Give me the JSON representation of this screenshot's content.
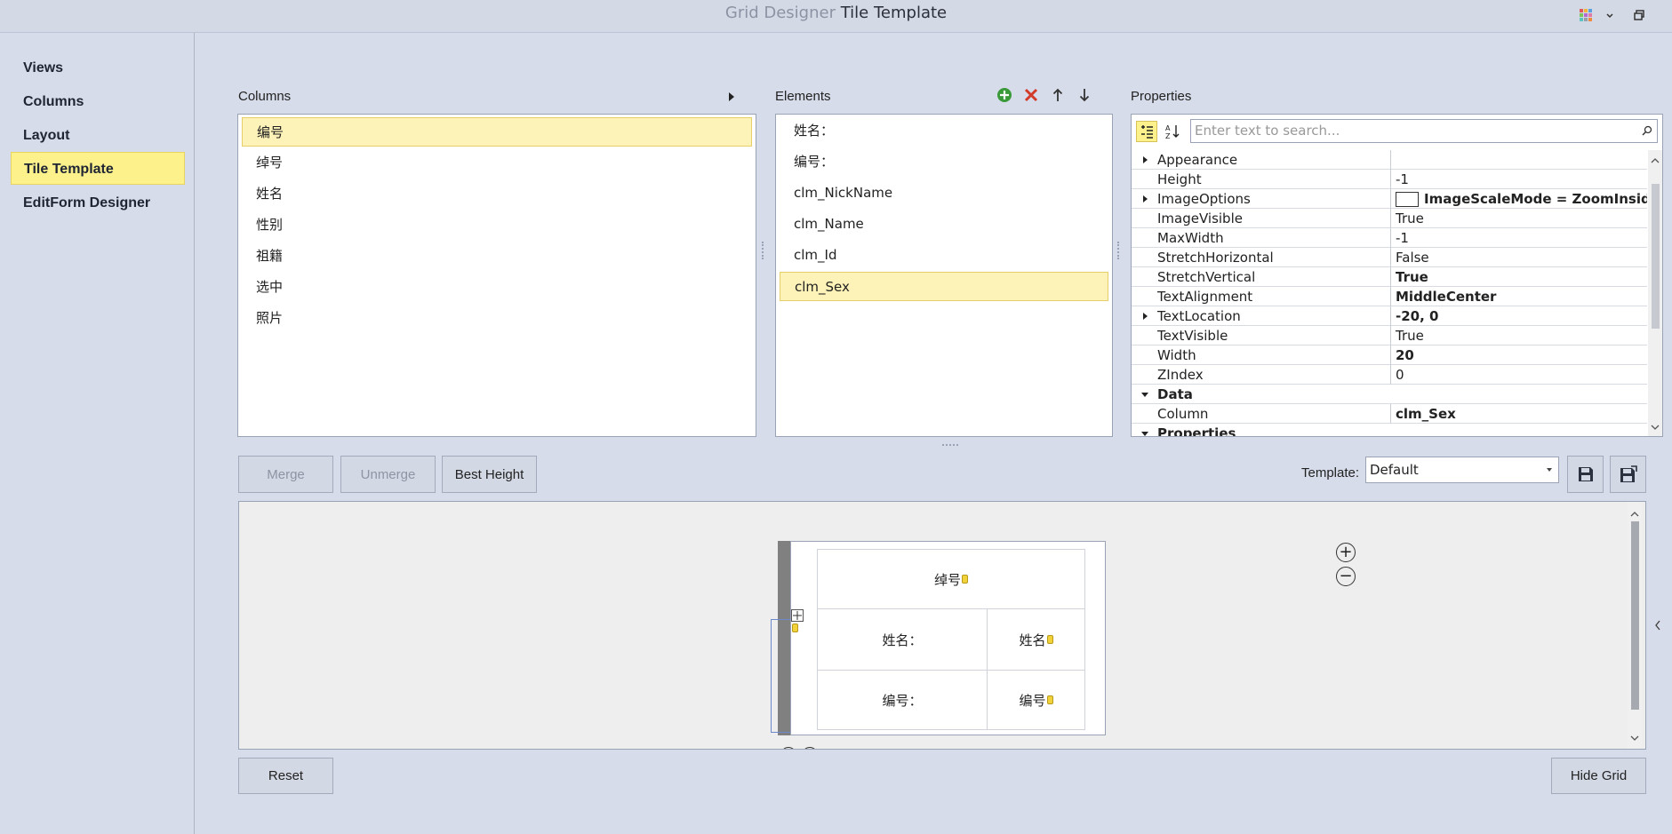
{
  "title": {
    "app": "Grid Designer",
    "page": "Tile Template"
  },
  "nav": {
    "items": [
      {
        "label": "Views",
        "selected": false
      },
      {
        "label": "Columns",
        "selected": false
      },
      {
        "label": "Layout",
        "selected": false
      },
      {
        "label": "Tile Template",
        "selected": true
      },
      {
        "label": "EditForm Designer",
        "selected": false
      }
    ]
  },
  "columns": {
    "label": "Columns",
    "items": [
      "编号",
      "绰号",
      "姓名",
      "性别",
      "祖籍",
      "选中",
      "照片"
    ],
    "selected_index": 0
  },
  "elements": {
    "label": "Elements",
    "items": [
      "姓名：",
      "编号：",
      "clm_NickName",
      "clm_Name",
      "clm_Id",
      "clm_Sex"
    ],
    "selected_index": 5
  },
  "properties": {
    "label": "Properties",
    "search_placeholder": "Enter text to search...",
    "rows": [
      {
        "name": "Appearance",
        "value": "",
        "expander": "collapsed",
        "bold": false
      },
      {
        "name": "Height",
        "value": "-1",
        "bold": false
      },
      {
        "name": "ImageOptions",
        "value": "ImageScaleMode = ZoomInside, In",
        "expander": "collapsed",
        "bold": true,
        "swatch": true
      },
      {
        "name": "ImageVisible",
        "value": "True",
        "bold": false
      },
      {
        "name": "MaxWidth",
        "value": "-1",
        "bold": false
      },
      {
        "name": "StretchHorizontal",
        "value": "False",
        "bold": false
      },
      {
        "name": "StretchVertical",
        "value": "True",
        "bold": true
      },
      {
        "name": "TextAlignment",
        "value": "MiddleCenter",
        "bold": true
      },
      {
        "name": "TextLocation",
        "value": "-20, 0",
        "expander": "collapsed",
        "bold": true
      },
      {
        "name": "TextVisible",
        "value": "True",
        "bold": false
      },
      {
        "name": "Width",
        "value": "20",
        "bold": true
      },
      {
        "name": "ZIndex",
        "value": "0",
        "bold": false
      }
    ],
    "data_category": "Data",
    "column_row": {
      "name": "Column",
      "value": "clm_Sex"
    },
    "properties_category": "Properties"
  },
  "buttons": {
    "merge": "Merge",
    "unmerge": "Unmerge",
    "best_height": "Best Height",
    "reset": "Reset",
    "hide_grid": "Hide Grid"
  },
  "template": {
    "label": "Template:",
    "value": "Default"
  },
  "tile": {
    "top_cell": "绰号",
    "row2_label": "姓名：",
    "row2_value": "姓名",
    "row3_label": "编号：",
    "row3_value": "编号"
  }
}
